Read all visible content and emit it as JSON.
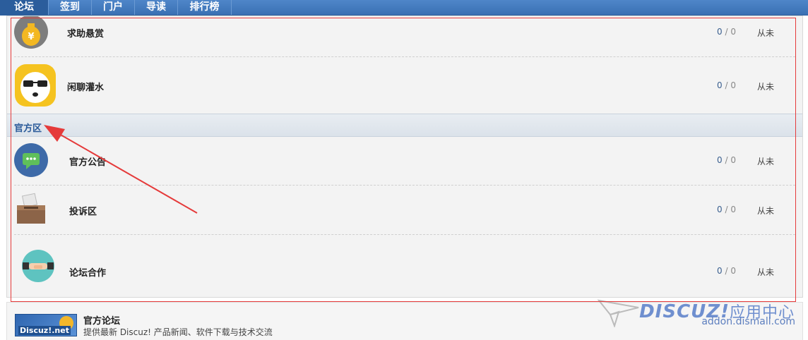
{
  "nav": {
    "items": [
      {
        "label": "论坛",
        "active": true
      },
      {
        "label": "签到"
      },
      {
        "label": "门户"
      },
      {
        "label": "导读"
      },
      {
        "label": "排行榜"
      }
    ]
  },
  "forums_top": [
    {
      "name": "求助悬赏",
      "icon": "money-bag-icon",
      "topics": "0",
      "posts": "0",
      "last": "从未"
    },
    {
      "name": "闲聊灌水",
      "icon": "sunglasses-face-icon",
      "topics": "0",
      "posts": "0",
      "last": "从未"
    }
  ],
  "category": {
    "title": "官方区"
  },
  "forums_official": [
    {
      "name": "官方公告",
      "icon": "chat-bubble-icon",
      "topics": "0",
      "posts": "0",
      "last": "从未"
    },
    {
      "name": "投诉区",
      "icon": "ballot-box-icon",
      "topics": "0",
      "posts": "0",
      "last": "从未"
    },
    {
      "name": "论坛合作",
      "icon": "handshake-icon",
      "topics": "0",
      "posts": "0",
      "last": "从未"
    }
  ],
  "separator": " / ",
  "footer": {
    "logo_text": "Discuz!.net",
    "title": "官方论坛",
    "description": "提供最新 Discuz! 产品新闻、软件下载与技术交流"
  },
  "watermark": {
    "brand": "DISCUZ!",
    "brand_cn": "应用中心",
    "url": "addon.dismall.com"
  },
  "colors": {
    "nav": "#3a70b3",
    "category_title": "#2a5a99",
    "annotation_red": "#e53a3a"
  }
}
